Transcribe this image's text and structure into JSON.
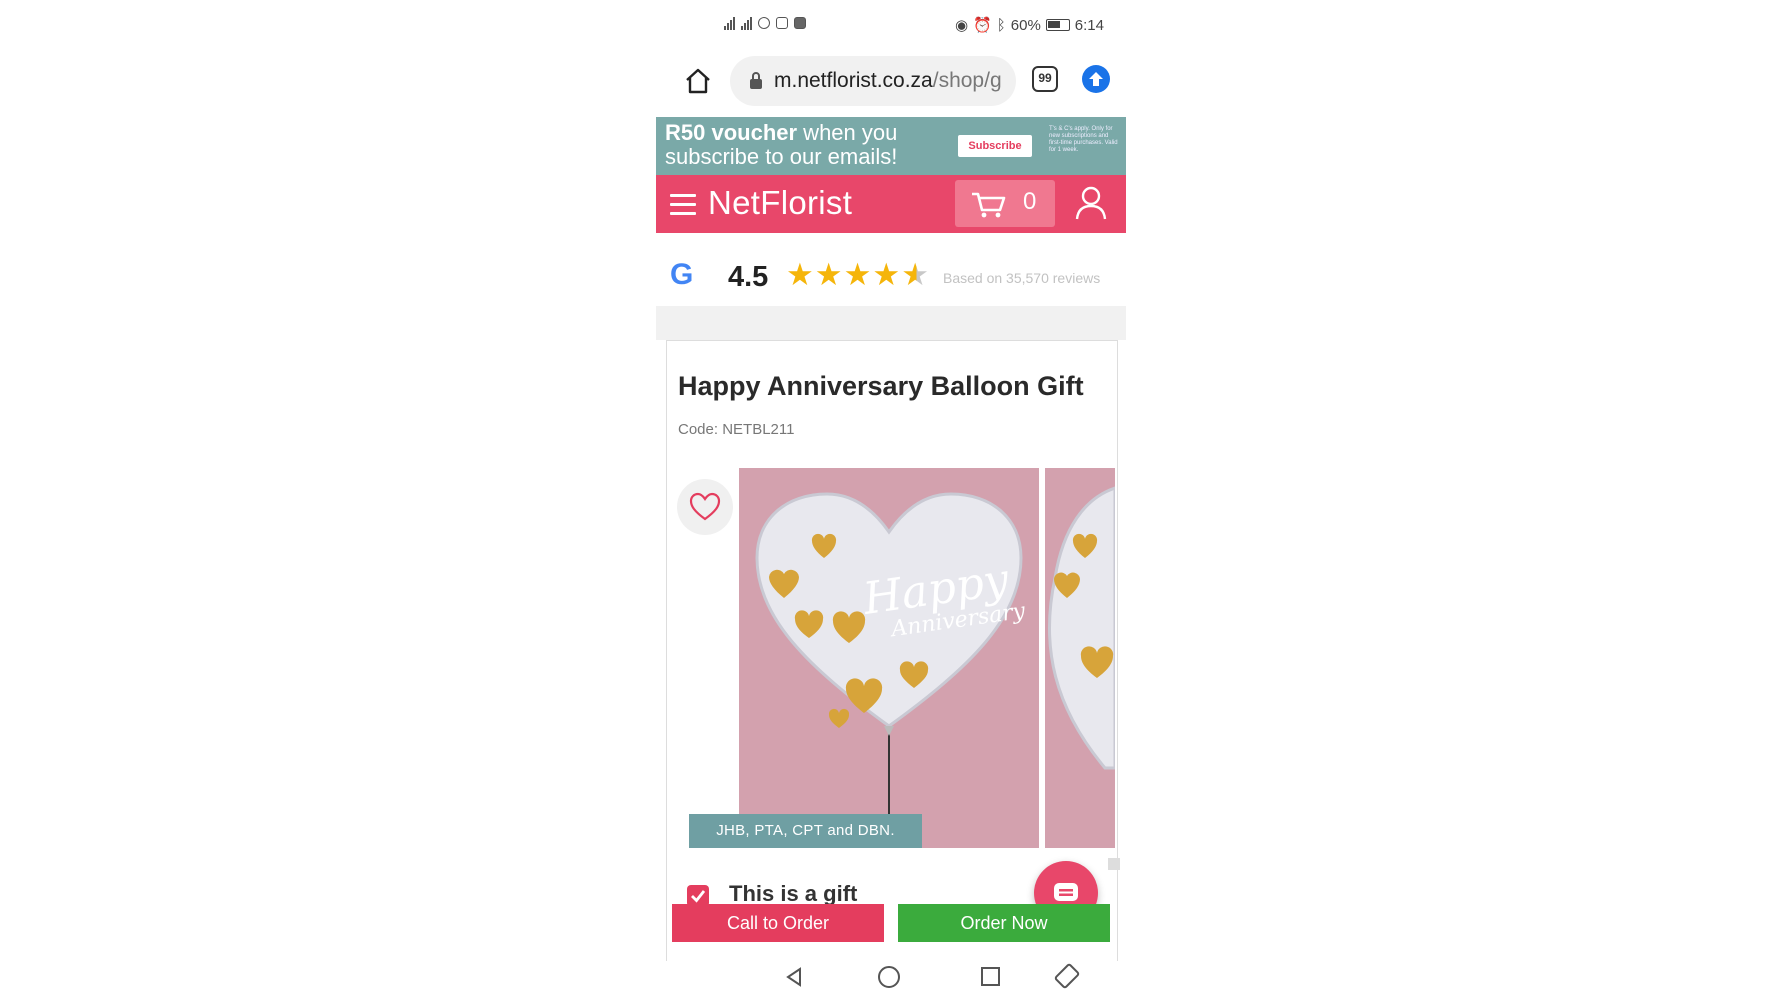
{
  "status_bar": {
    "battery": "60%",
    "time": "6:14"
  },
  "browser": {
    "url_domain": "m.netflorist.co.za",
    "url_path": "/shop/g",
    "tab_count": "99"
  },
  "promo": {
    "headline_bold": "R50 voucher",
    "headline_rest": " when you",
    "line2": "subscribe to our emails!",
    "subscribe_label": "Subscribe",
    "terms": "T's & C's apply. Only for new subscriptions and first-time purchases. Valid for 1 week."
  },
  "header": {
    "logo": "NetFlorist",
    "cart_count": "0"
  },
  "reviews": {
    "rating": "4.5",
    "stars": 4.5,
    "note": "Based on 35,570 reviews"
  },
  "product": {
    "title": "Happy Anniversary Balloon Gift",
    "code": "Code: NETBL211",
    "balloon_line1": "Happy",
    "balloon_line2": "Anniversary",
    "delivery_badge": "JHB, PTA, CPT and DBN.",
    "gift_label": "This is a gift"
  },
  "actions": {
    "call_label": "Call to Order",
    "order_label": "Order Now"
  },
  "colors": {
    "brand": "#e8476a",
    "promo_bg": "#7aa9a8",
    "order_green": "#3bab3d",
    "star": "#f5b50a"
  }
}
